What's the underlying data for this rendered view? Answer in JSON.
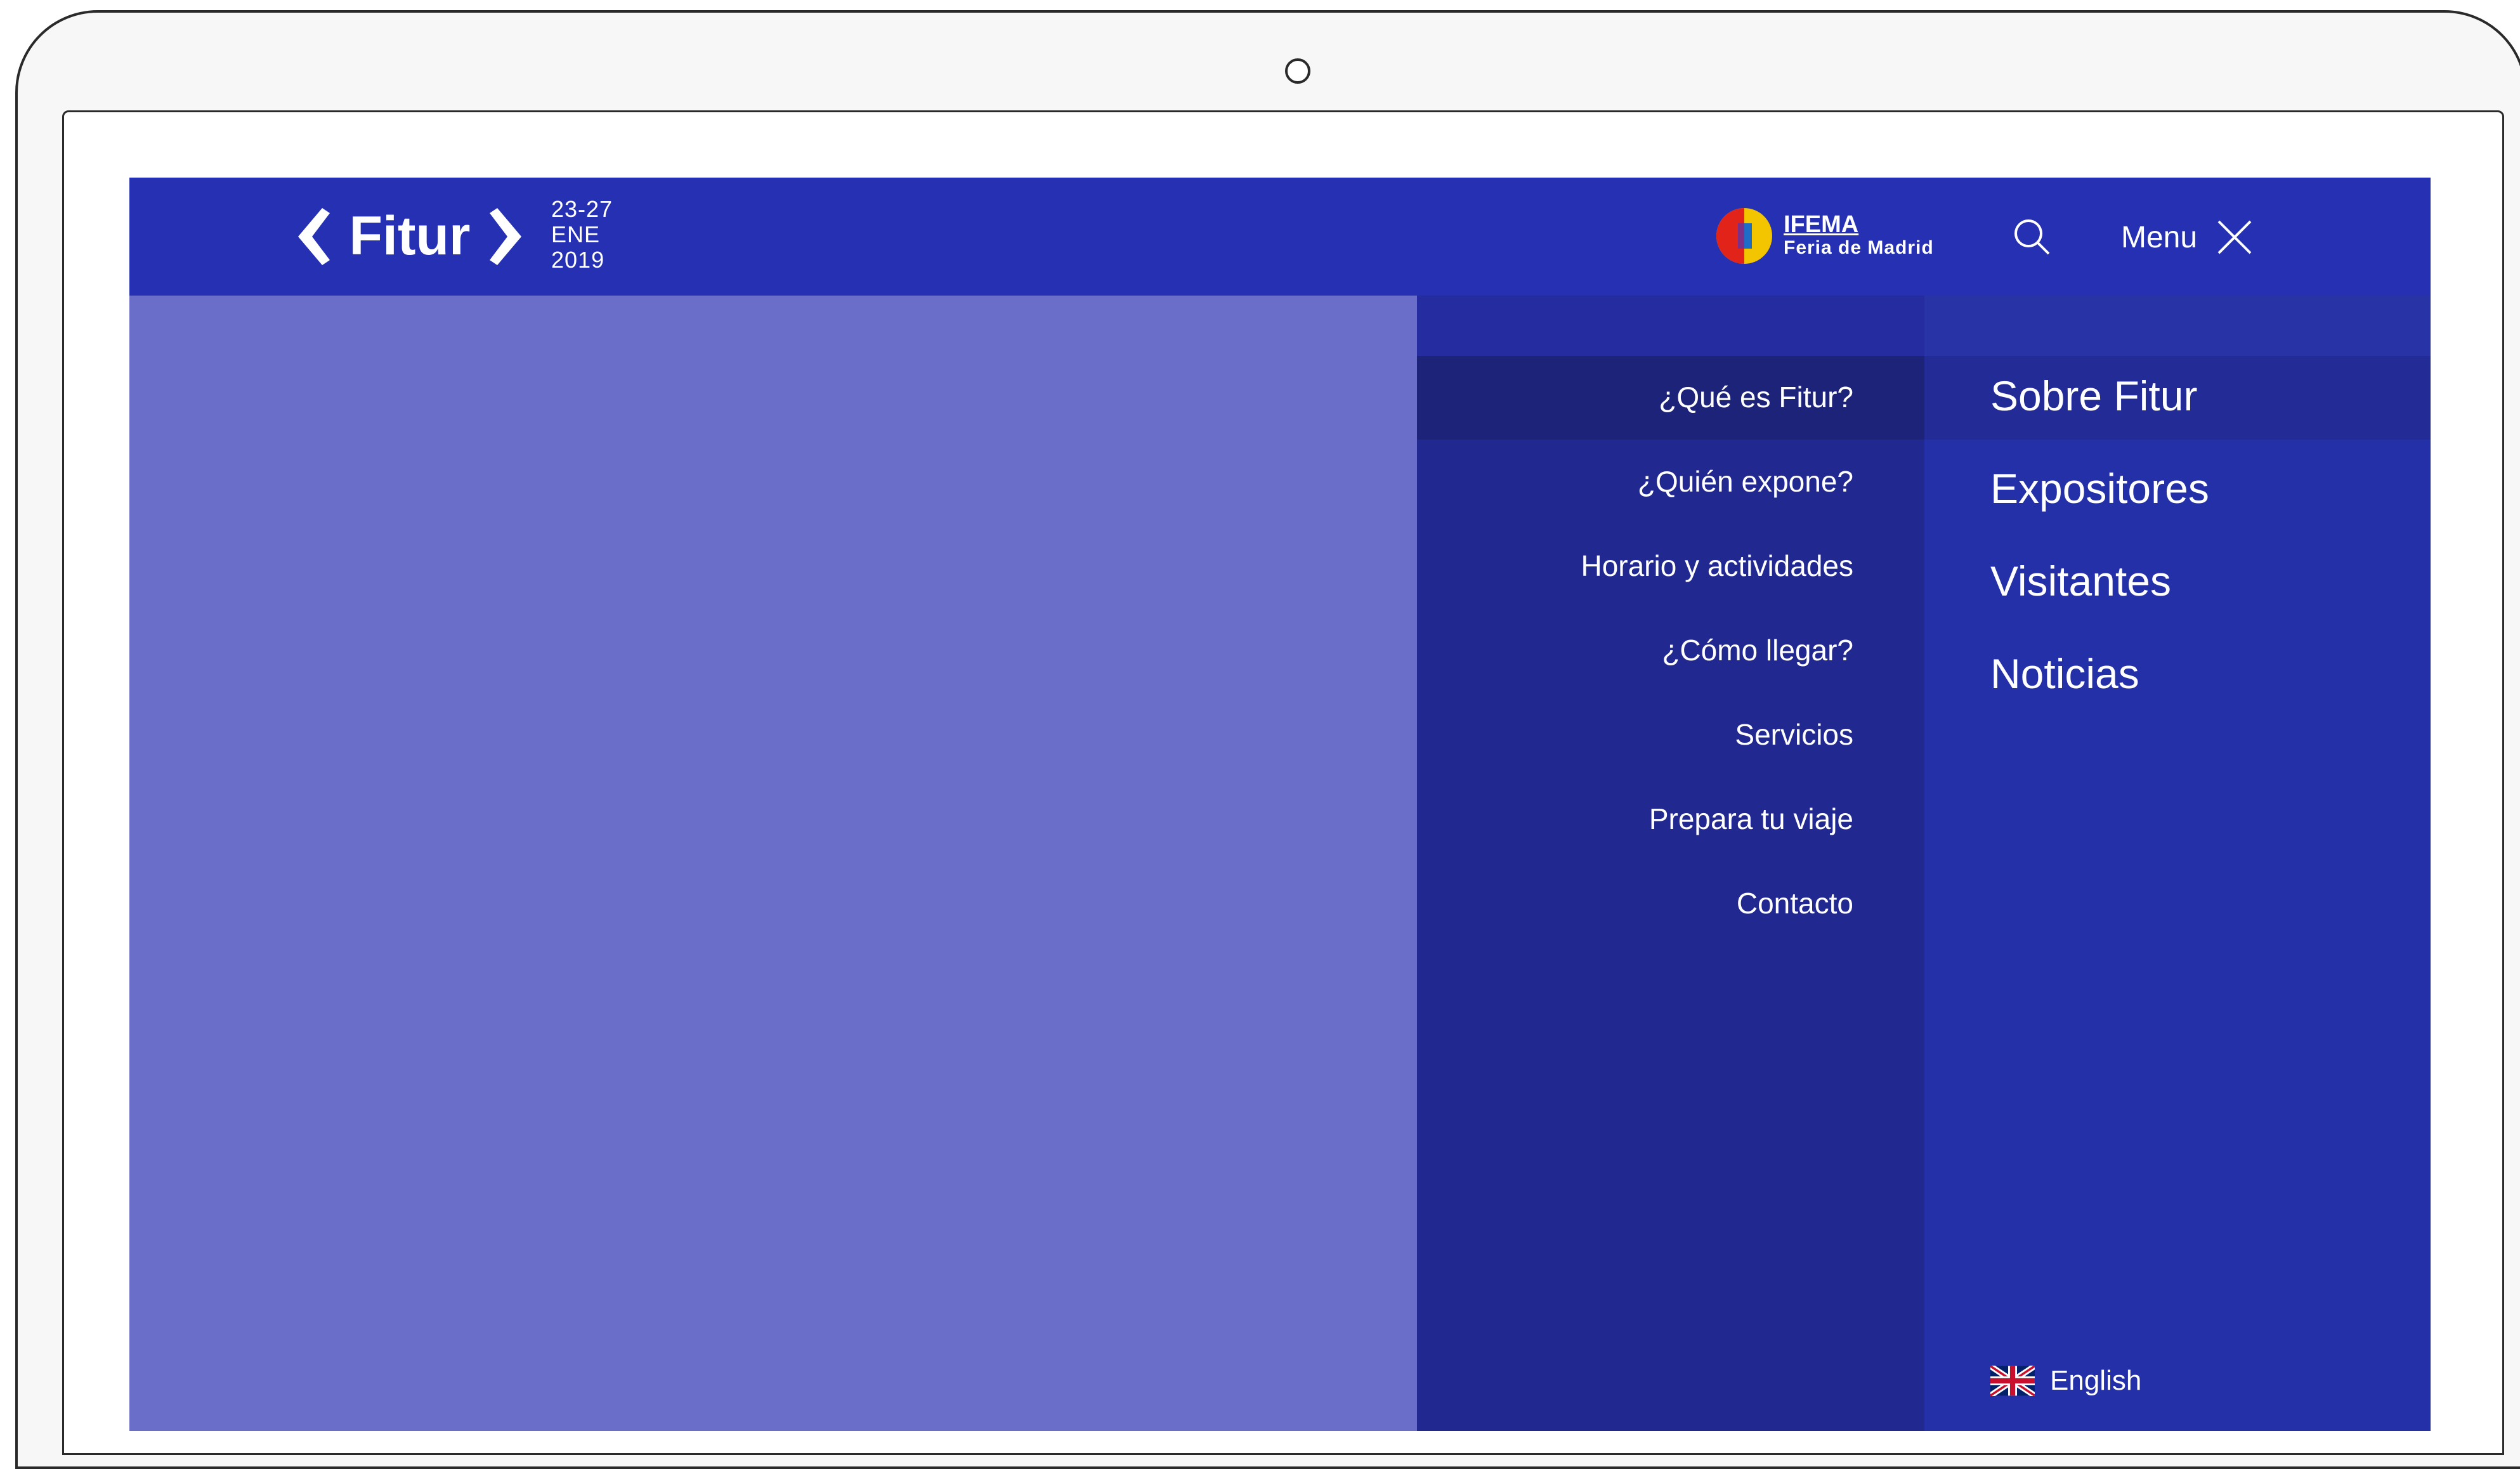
{
  "header": {
    "logo_text": "Fitur",
    "dates": [
      "23-27",
      "ENE",
      "2019"
    ],
    "ifema": {
      "name": "IFEMA",
      "subtitle": "Feria de Madrid"
    },
    "search_icon": "search-icon",
    "menu_label": "Menu",
    "menu_close_icon": "close-icon"
  },
  "secondary_menu": {
    "active_index": 0,
    "items": [
      {
        "label": "¿Qué es Fitur?"
      },
      {
        "label": "¿Quién expone?"
      },
      {
        "label": "Horario y actividades"
      },
      {
        "label": "¿Cómo llegar?"
      },
      {
        "label": "Servicios"
      },
      {
        "label": "Prepara tu viaje"
      },
      {
        "label": "Contacto"
      }
    ]
  },
  "primary_menu": {
    "active_index": 0,
    "items": [
      {
        "label": "Sobre Fitur"
      },
      {
        "label": "Expositores"
      },
      {
        "label": "Visitantes"
      },
      {
        "label": "Noticias"
      }
    ]
  },
  "language": {
    "label": "English",
    "flag_icon": "uk-flag-icon"
  },
  "colors": {
    "header_bg": "#2530b3",
    "content_bg": "#6a6ec8",
    "secondary_bg": "#21288f",
    "secondary_active": "#1c2378",
    "primary_bg": "#2430a8"
  }
}
